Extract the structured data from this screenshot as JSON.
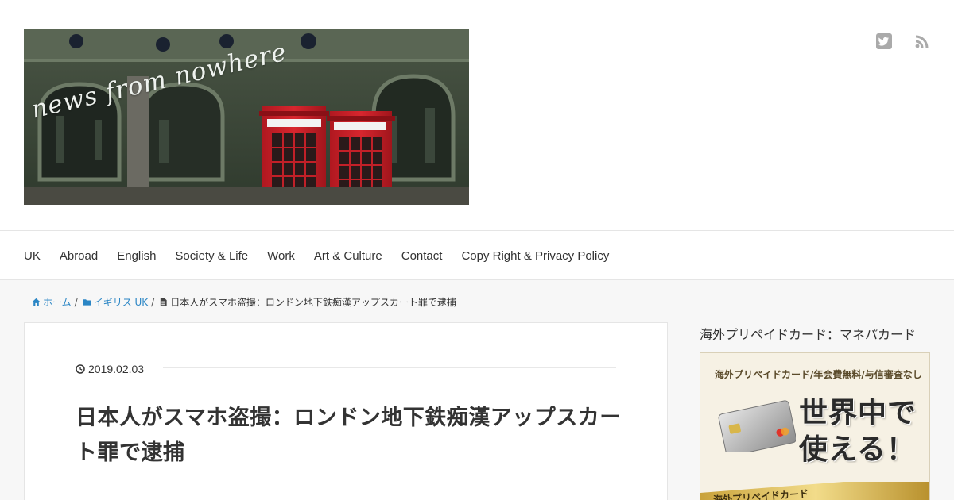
{
  "header": {
    "logo_text": "news from nowhere",
    "icons": [
      "twitter-icon",
      "rss-icon"
    ],
    "icon_color": "#aaaaaa"
  },
  "nav": {
    "items": [
      "UK",
      "Abroad",
      "English",
      "Society & Life",
      "Work",
      "Art & Culture",
      "Contact",
      "Copy Right & Privacy Policy"
    ]
  },
  "breadcrumb": {
    "home": "ホーム",
    "category": "イギリス UK",
    "current": "日本人がスマホ盗撮：ロンドン地下鉄痴漢アップスカート罪で逮捕",
    "separator": "/",
    "link_color": "#2b86c5"
  },
  "article": {
    "date": "2019.02.03",
    "title": "日本人がスマホ盗撮：ロンドン地下鉄痴漢アップスカート罪で逮捕"
  },
  "sidebar": {
    "widget_title": "海外プリペイドカード：マネパカード",
    "ad": {
      "top_text": "海外プリペイドカード/年会費無料/与信審査なし",
      "main_line1": "世界中で",
      "main_line2": "使える！",
      "bottom_text": "海外プリペイドカード"
    }
  }
}
